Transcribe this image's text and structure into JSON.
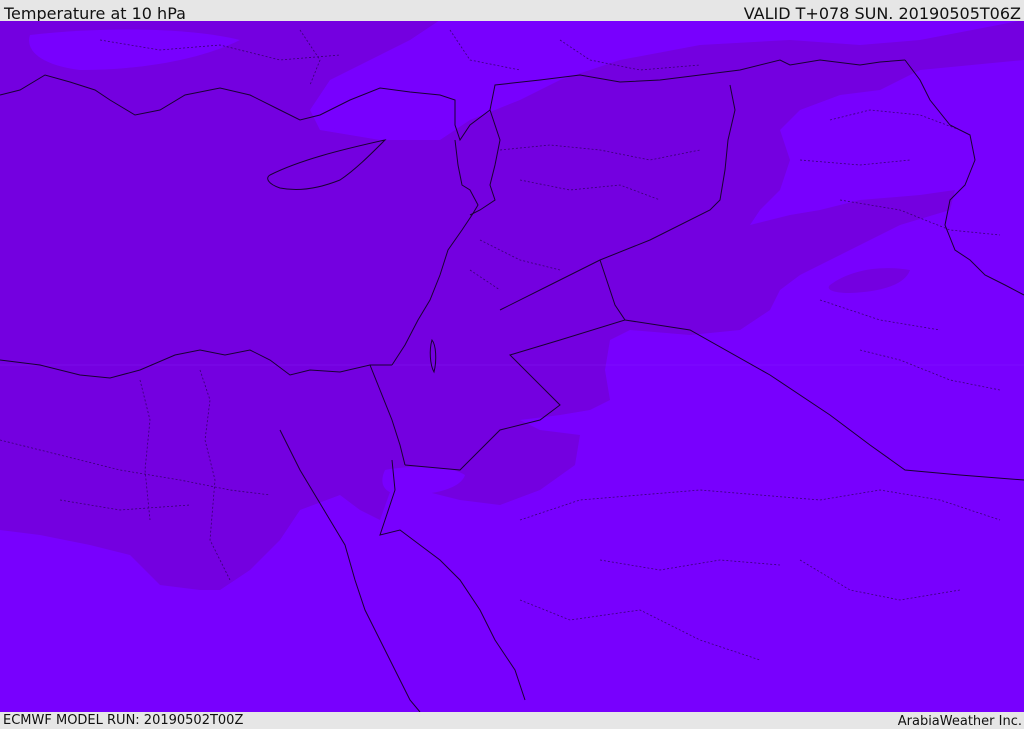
{
  "header": {
    "title": "Temperature at 10 hPa",
    "valid": "VALID T+078 SUN. 20190505T06Z"
  },
  "footer": {
    "model_run": "ECMWF MODEL RUN: 20190502T00Z",
    "credit": "ArabiaWeather Inc."
  },
  "map": {
    "colors": {
      "warm_band": "#7400e0",
      "cool_band": "#7800fe",
      "coastline": "#1a0033"
    }
  }
}
